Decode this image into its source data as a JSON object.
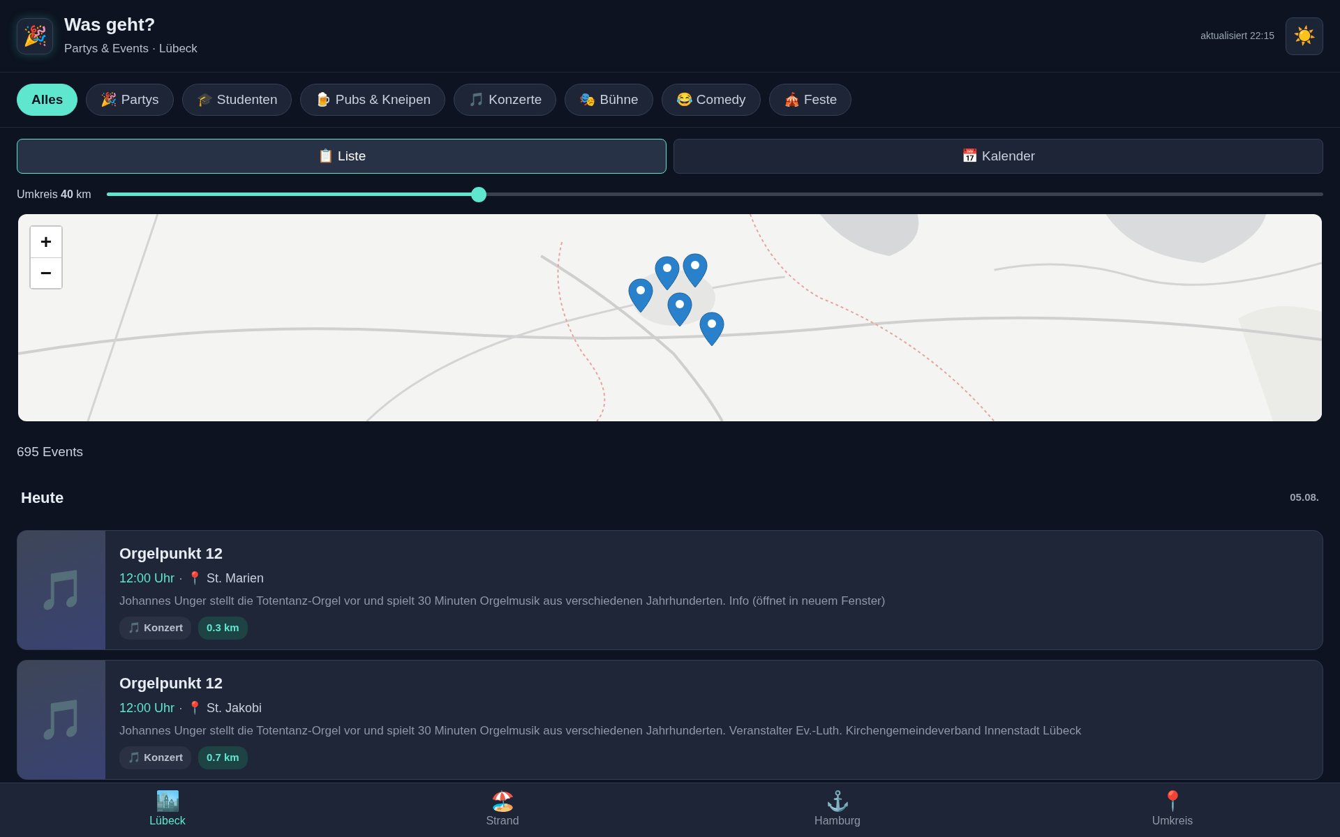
{
  "header": {
    "logo": "🎉",
    "title": "Was geht?",
    "subtitle": "Partys & Events · Lübeck",
    "updated": "aktualisiert 22:15",
    "theme_toggle": "☀️"
  },
  "categories": [
    {
      "label": "Alles",
      "selected": true
    },
    {
      "label": "🎉 Partys",
      "selected": false
    },
    {
      "label": "🎓 Studenten",
      "selected": false
    },
    {
      "label": "🍺 Pubs & Kneipen",
      "selected": false
    },
    {
      "label": "🎵 Konzerte",
      "selected": false
    },
    {
      "label": "🎭 Bühne",
      "selected": false
    },
    {
      "label": "😂 Comedy",
      "selected": false
    },
    {
      "label": "🎪 Feste",
      "selected": false
    }
  ],
  "view_tabs": [
    {
      "label": "📋 Liste",
      "selected": true
    },
    {
      "label": "📅 Kalender",
      "selected": false
    }
  ],
  "radius": {
    "label": "Umkreis **40** km",
    "level": 0.306
  },
  "map": {
    "kind": "picture",
    "zoom_in": "+",
    "zoom_out": "−"
  },
  "event_count": "695 Events",
  "day": {
    "title": "Heute",
    "date": "05.08."
  },
  "events": [
    {
      "icon": "🎵",
      "title": "Orgelpunkt 12",
      "time": "12:00 Uhr",
      "sep": "·",
      "pin": "📍",
      "venue": "St. Marien",
      "description": "Johannes Unger stellt die Totentanz-Orgel vor und spielt 30 Minuten Orgelmusik aus verschiedenen Jahrhunderten. Info (öffnet in neuem Fenster)",
      "tag": "🎵 Konzert",
      "distance": "0.3 km"
    },
    {
      "icon": "🎵",
      "title": "Orgelpunkt 12",
      "time": "12:00 Uhr",
      "sep": "·",
      "pin": "📍",
      "venue": "St. Jakobi",
      "description": "Johannes Unger stellt die Totentanz-Orgel vor und spielt 30 Minuten Orgelmusik aus verschiedenen Jahrhunderten. Veranstalter Ev.-Luth. Kirchengemeindeverband Innenstadt Lübeck",
      "tag": "🎵 Konzert",
      "distance": "0.7 km"
    }
  ],
  "bottom_nav": [
    {
      "icon": "🏙️",
      "label": "Lübeck",
      "selected": true
    },
    {
      "icon": "🏖️",
      "label": "Strand",
      "selected": false
    },
    {
      "icon": "⚓",
      "label": "Hamburg",
      "selected": false
    },
    {
      "icon": "📍",
      "label": "Umkreis",
      "selected": false
    }
  ]
}
